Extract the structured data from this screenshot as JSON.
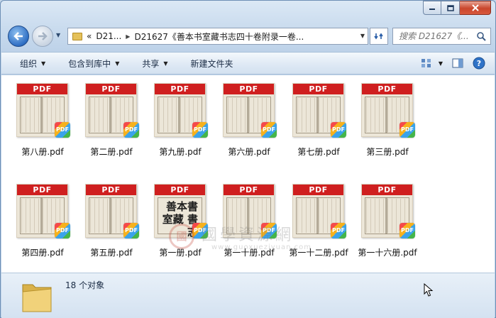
{
  "window": {
    "caption": {
      "minimize_icon": "minimize-icon",
      "maximize_icon": "maximize-icon",
      "close_icon": "close-icon"
    }
  },
  "address": {
    "overflow": "«",
    "crumb1": "D21...",
    "crumb2": "D21627《善本书室藏书志四十卷附录一卷..."
  },
  "search": {
    "placeholder": "搜索 D21627《..."
  },
  "toolbar": {
    "organize": "组织",
    "include_in_library": "包含到库中",
    "share": "共享",
    "new_folder": "新建文件夹"
  },
  "files": [
    {
      "label": "第八册.pdf",
      "thumb": "PDF",
      "badge": "PDF"
    },
    {
      "label": "第二册.pdf",
      "thumb": "PDF",
      "badge": "PDF"
    },
    {
      "label": "第九册.pdf",
      "thumb": "PDF",
      "badge": "PDF"
    },
    {
      "label": "第六册.pdf",
      "thumb": "PDF",
      "badge": "PDF"
    },
    {
      "label": "第七册.pdf",
      "thumb": "PDF",
      "badge": "PDF"
    },
    {
      "label": "第三册.pdf",
      "thumb": "PDF",
      "badge": "PDF"
    },
    {
      "label": "第四册.pdf",
      "thumb": "PDF",
      "badge": "PDF"
    },
    {
      "label": "第五册.pdf",
      "thumb": "PDF",
      "badge": "PDF"
    },
    {
      "label": "第一册.pdf",
      "thumb": "PDF",
      "badge": "PDF",
      "cover_text": "善本書 室藏 書志"
    },
    {
      "label": "第一十册.pdf",
      "thumb": "PDF",
      "badge": "PDF"
    },
    {
      "label": "第一十二册.pdf",
      "thumb": "PDF",
      "badge": "PDF"
    },
    {
      "label": "第一十六册.pdf",
      "thumb": "PDF",
      "badge": "PDF"
    }
  ],
  "watermark": {
    "seal": "國",
    "title": "國學資源網",
    "url": "www.guoxueziyuan.com"
  },
  "status": {
    "count_text": "18 个对象"
  },
  "colors": {
    "pdf_band": "#cf1f1f",
    "window_chrome": "#c9dbee",
    "toolbar": "#dde8f4"
  }
}
